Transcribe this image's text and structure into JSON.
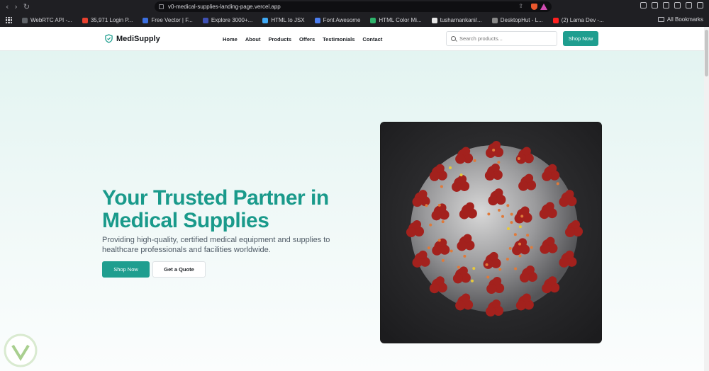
{
  "browser": {
    "url": "v0-medical-supplies-landing-page.vercel.app",
    "bookmarks": [
      {
        "label": "WebRTC API -...",
        "color": "#5f6368"
      },
      {
        "label": "35,971 Login P...",
        "color": "#e8412f"
      },
      {
        "label": "Free Vector | F...",
        "color": "#3b6fe0"
      },
      {
        "label": "Explore 3000+...",
        "color": "#3f51b5"
      },
      {
        "label": "HTML to JSX",
        "color": "#3fa9f5"
      },
      {
        "label": "Font Awesome",
        "color": "#4c7ef0"
      },
      {
        "label": "HTML Color Mi...",
        "color": "#2eb36b"
      },
      {
        "label": "tusharnankani/...",
        "color": "#e6e6e6"
      },
      {
        "label": "DesktopHut - L...",
        "color": "#888888"
      },
      {
        "label": "(2) Lama Dev -...",
        "color": "#ff2020"
      }
    ],
    "all_bookmarks": "All Bookmarks"
  },
  "header": {
    "brand": "MediSupply",
    "nav": [
      "Home",
      "About",
      "Products",
      "Offers",
      "Testimonials",
      "Contact"
    ],
    "search_placeholder": "Search products...",
    "cta": "Shop Now"
  },
  "hero": {
    "title": "Your Trusted Partner in Medical Supplies",
    "description": "Providing high-quality, certified medical equipment and supplies to healthcare professionals and facilities worldwide.",
    "primary_button": "Shop Now",
    "secondary_button": "Get a Quote"
  },
  "colors": {
    "accent": "#1f9e8f",
    "title": "#1a9a8b",
    "chrome": "#1f1f23"
  }
}
